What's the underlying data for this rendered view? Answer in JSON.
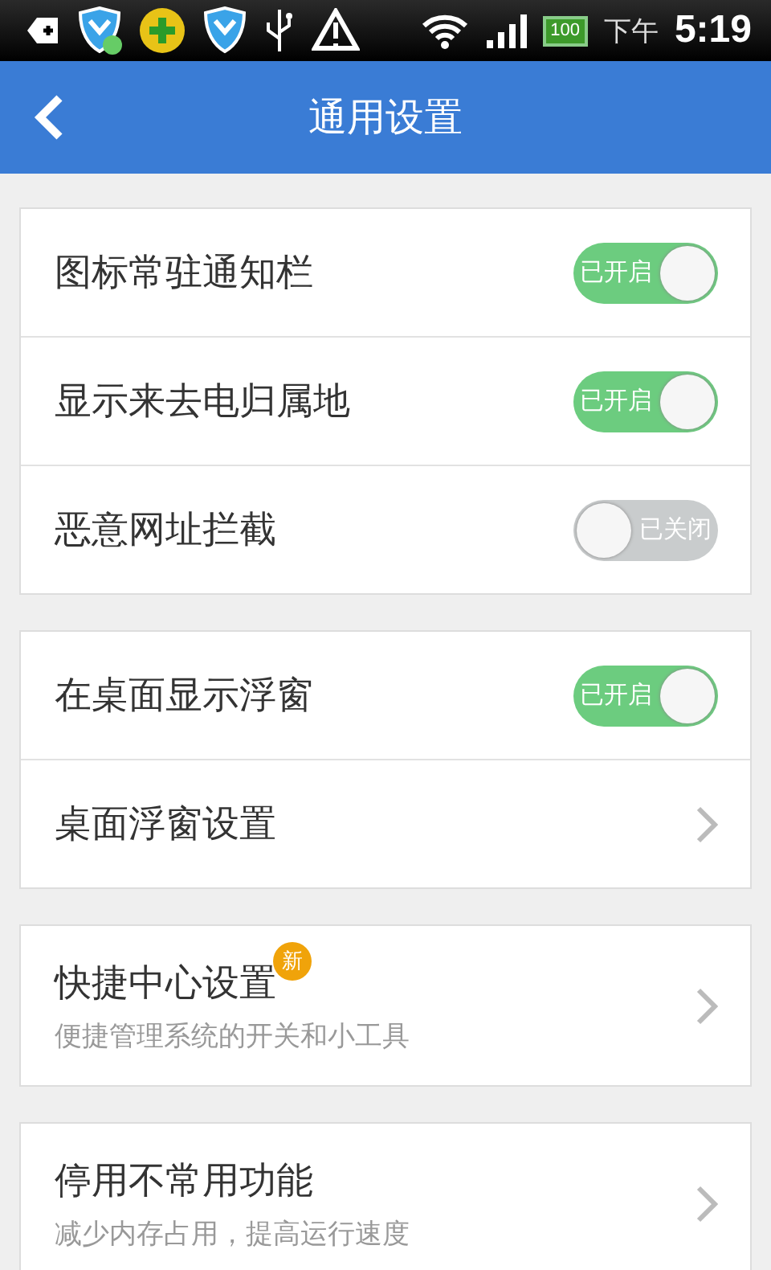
{
  "status_bar": {
    "battery": "100",
    "period": "下午",
    "time": "5:19"
  },
  "header": {
    "title": "通用设置"
  },
  "groups": [
    {
      "items": [
        {
          "kind": "toggle",
          "label": "图标常驻通知栏",
          "on": true,
          "switch_text": "已开启"
        },
        {
          "kind": "toggle",
          "label": "显示来去电归属地",
          "on": true,
          "switch_text": "已开启"
        },
        {
          "kind": "toggle",
          "label": "恶意网址拦截",
          "on": false,
          "switch_text": "已关闭"
        }
      ]
    },
    {
      "items": [
        {
          "kind": "toggle",
          "label": "在桌面显示浮窗",
          "on": true,
          "switch_text": "已开启"
        },
        {
          "kind": "link",
          "label": "桌面浮窗设置"
        }
      ]
    },
    {
      "items": [
        {
          "kind": "link",
          "label": "快捷中心设置",
          "badge": "新",
          "subtitle": "便捷管理系统的开关和小工具"
        }
      ]
    },
    {
      "items": [
        {
          "kind": "link",
          "label": "停用不常用功能",
          "subtitle": "减少内存占用，提高运行速度"
        }
      ]
    }
  ]
}
